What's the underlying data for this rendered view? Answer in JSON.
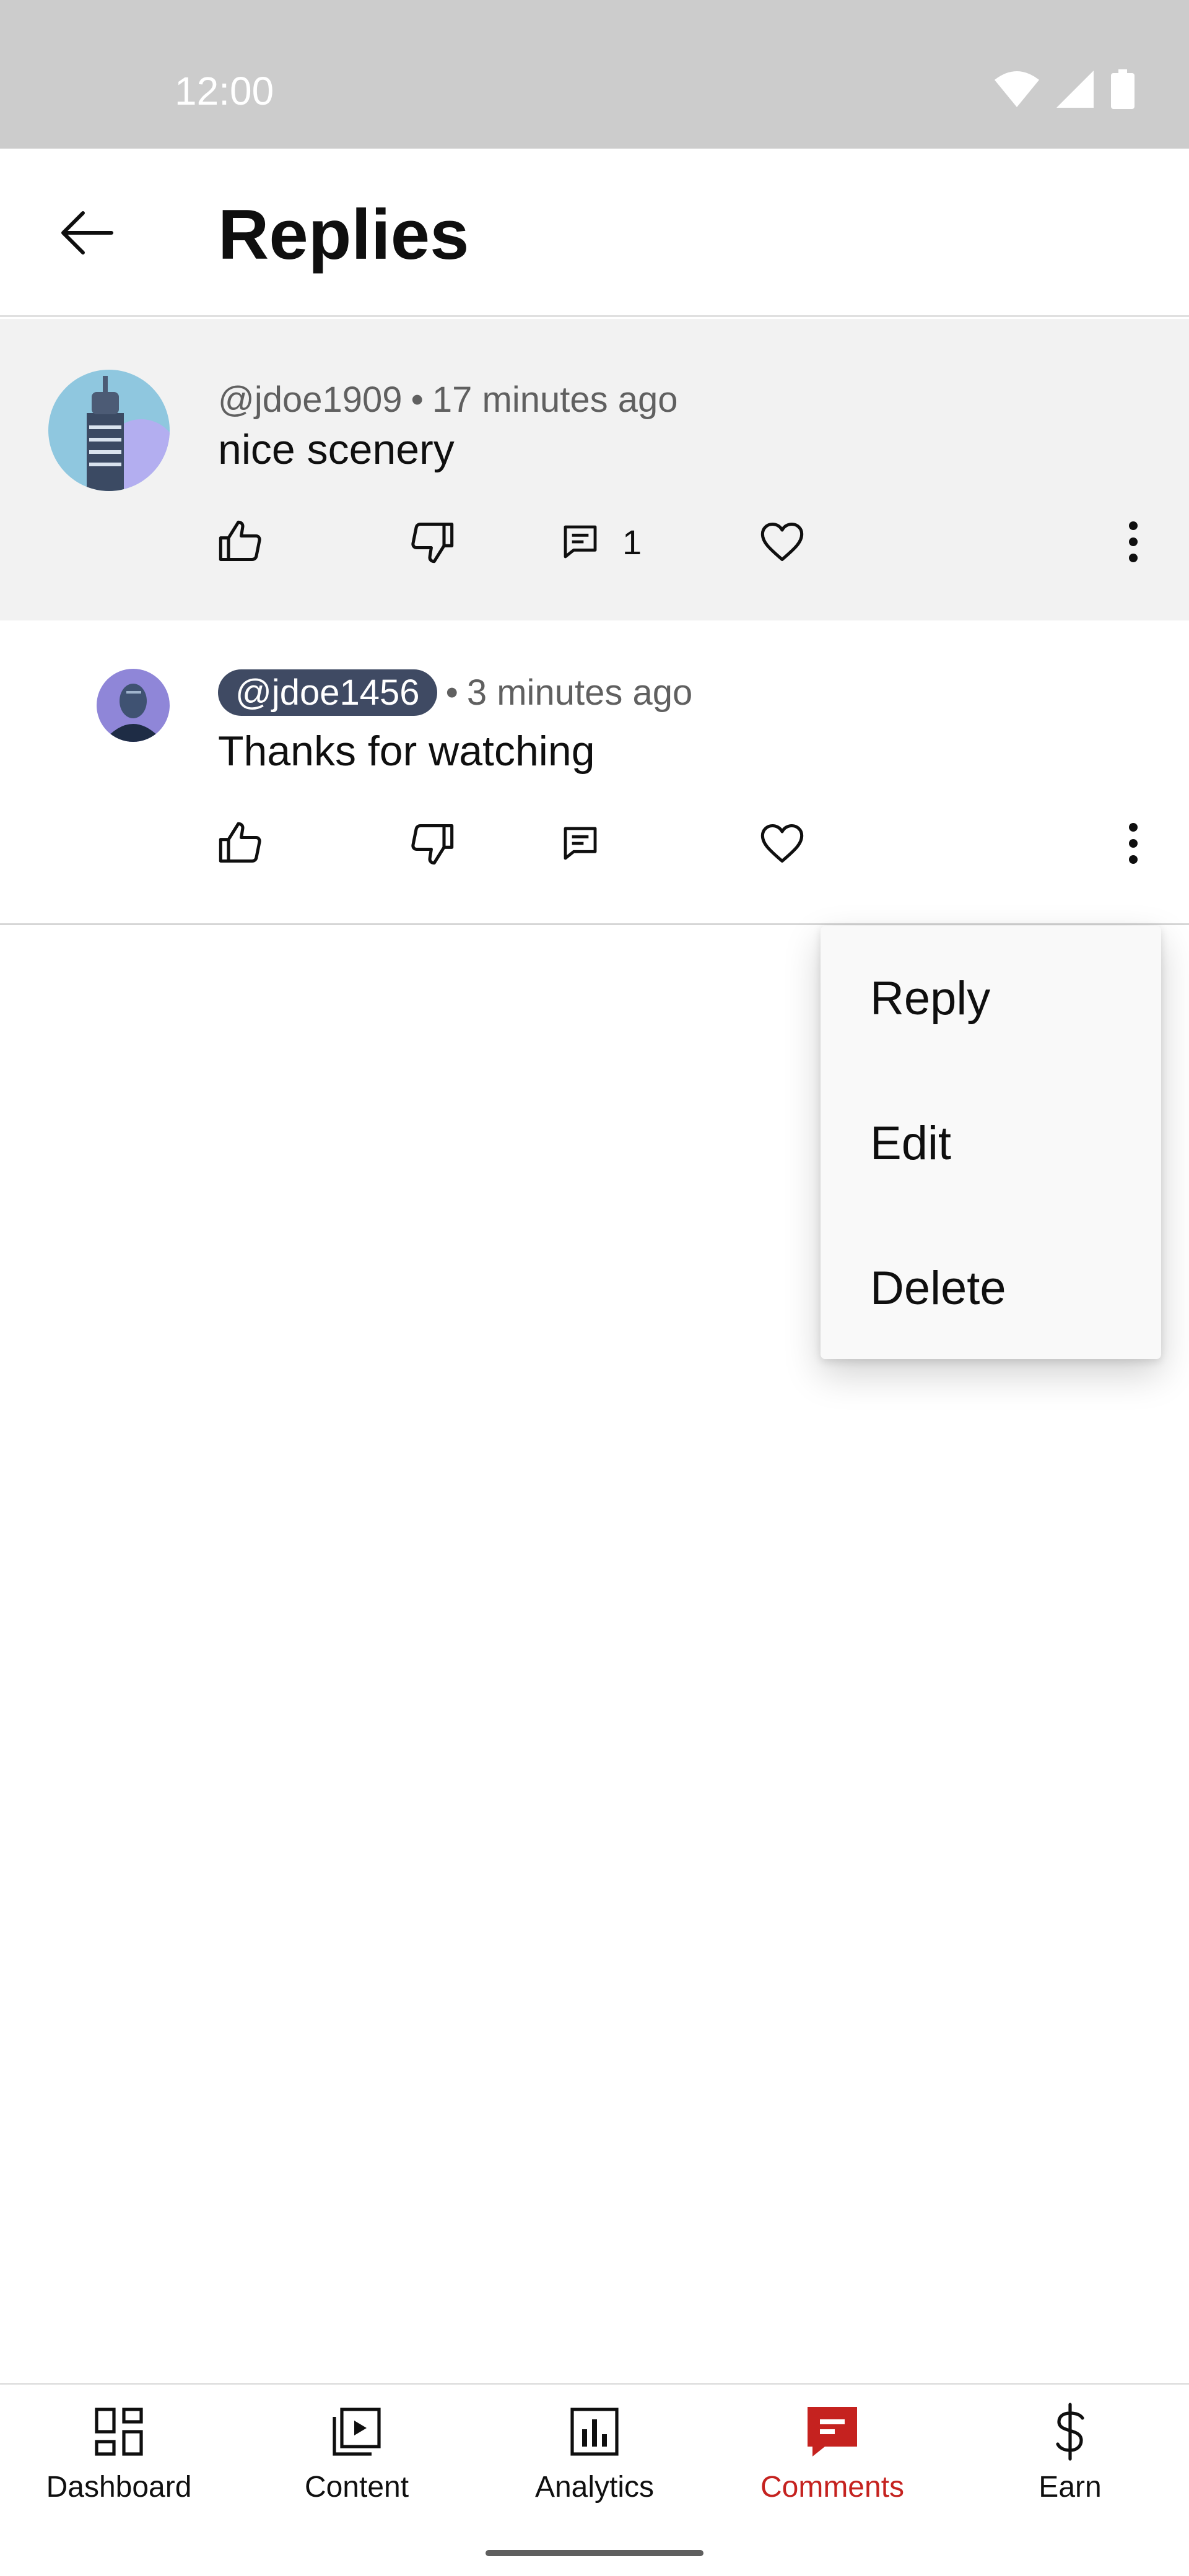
{
  "status_bar": {
    "time": "12:00",
    "icons": [
      "wifi-icon",
      "signal-icon",
      "battery-icon"
    ]
  },
  "header": {
    "title": "Replies",
    "back_icon": "arrow-back-icon"
  },
  "parent_comment": {
    "handle": "@jdoe1909",
    "separator": "•",
    "time_ago": "17 minutes ago",
    "text": "nice scenery",
    "reply_count": "1"
  },
  "reply_comment": {
    "handle": "@jdoe1456",
    "separator": "•",
    "time_ago": "3 minutes ago",
    "text": "Thanks for watching"
  },
  "menu": {
    "items": [
      "Reply",
      "Edit",
      "Delete"
    ]
  },
  "bottom_nav": {
    "items": [
      {
        "label": "Dashboard",
        "icon": "dashboard-icon"
      },
      {
        "label": "Content",
        "icon": "content-icon"
      },
      {
        "label": "Analytics",
        "icon": "analytics-icon"
      },
      {
        "label": "Comments",
        "icon": "comments-icon",
        "active": true
      },
      {
        "label": "Earn",
        "icon": "dollar-icon"
      }
    ]
  },
  "colors": {
    "accent": "#c5221f",
    "chip": "#3f4a63",
    "status_bar": "#cccccc"
  }
}
